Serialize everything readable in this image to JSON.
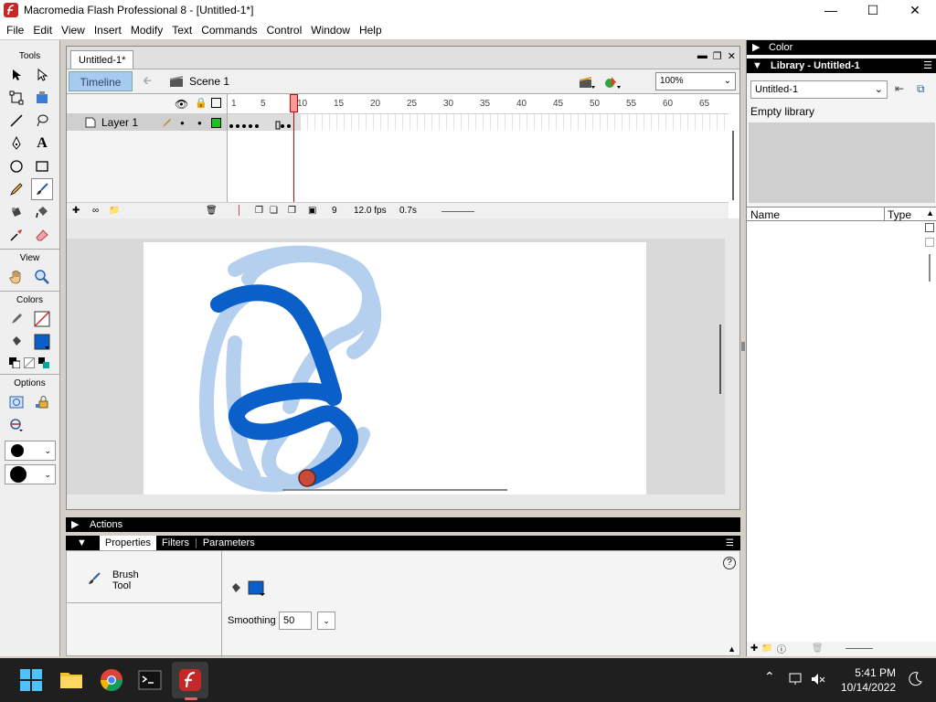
{
  "window": {
    "title": "Macromedia Flash Professional 8 - [Untitled-1*]",
    "controls": [
      "—",
      "☐",
      "✕"
    ]
  },
  "menu": [
    "File",
    "Edit",
    "View",
    "Insert",
    "Modify",
    "Text",
    "Commands",
    "Control",
    "Window",
    "Help"
  ],
  "tools": {
    "label": "Tools",
    "view_label": "View",
    "colors_label": "Colors",
    "options_label": "Options"
  },
  "document": {
    "tab": "Untitled-1*",
    "timeline_btn": "Timeline",
    "scene": "Scene 1",
    "zoom": "100%"
  },
  "timeline": {
    "layer_name": "Layer 1",
    "ruler": [
      "1",
      "5",
      "10",
      "15",
      "20",
      "25",
      "30",
      "35",
      "40",
      "45",
      "50",
      "55",
      "60",
      "65"
    ],
    "current_frame": "9",
    "fps": "12.0 fps",
    "time": "0.7s"
  },
  "panels": {
    "actions": "Actions",
    "tabs": [
      "Properties",
      "Filters",
      "Parameters"
    ],
    "tool_name_1": "Brush",
    "tool_name_2": "Tool",
    "smoothing_label": "Smoothing",
    "smoothing_value": "50"
  },
  "right": {
    "color_panel": "Color",
    "library_panel": "Library - Untitled-1",
    "library_select": "Untitled-1",
    "empty": "Empty library",
    "col_name": "Name",
    "col_type": "Type"
  },
  "taskbar": {
    "time": "5:41 PM",
    "date": "10/14/2022"
  },
  "colors": {
    "stroke_blue": "#0a5fc8",
    "onion_blue": "#a9c8ec"
  }
}
